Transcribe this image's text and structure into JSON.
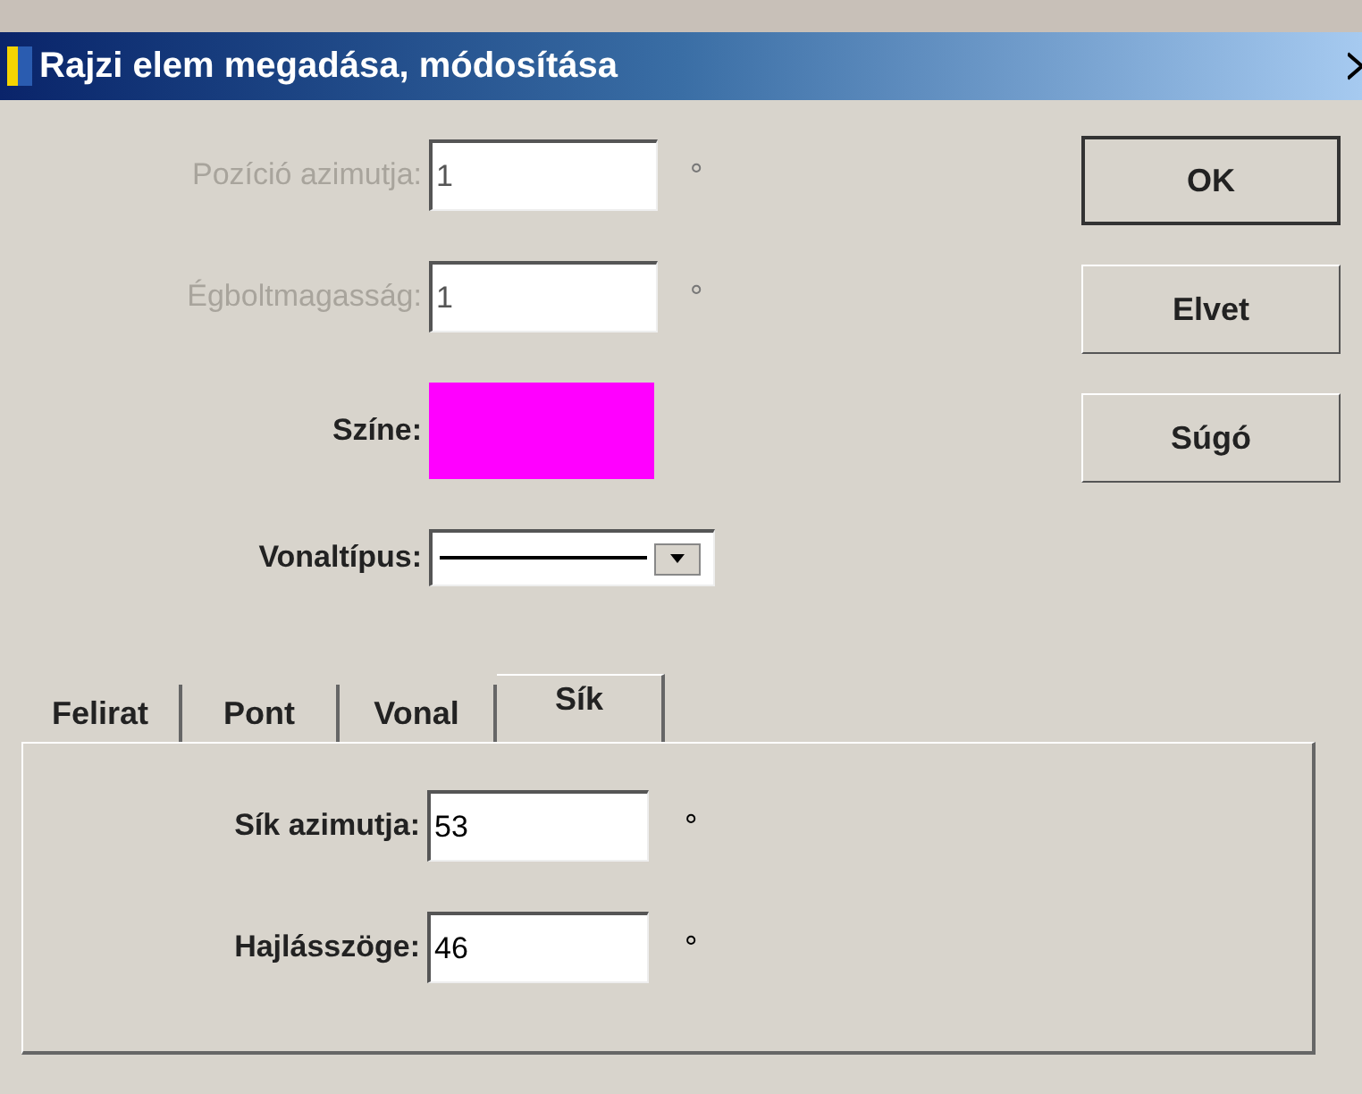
{
  "window": {
    "title": "Rajzi elem megadása, módosítása"
  },
  "fields": [
    {
      "kind": "text",
      "label": "Pozíció azimutja:",
      "value": "1",
      "unit": "°",
      "disabled": true
    },
    {
      "kind": "text",
      "label": "Égboltmagasság:",
      "value": "1",
      "unit": "°",
      "disabled": true
    },
    {
      "kind": "color",
      "label": "Színe:",
      "color": "#ff00ff"
    },
    {
      "kind": "linetype",
      "label": "Vonaltípus:"
    }
  ],
  "buttons": [
    {
      "label": "OK",
      "default": true
    },
    {
      "label": "Elvet",
      "default": false
    },
    {
      "label": "Súgó",
      "default": false
    }
  ],
  "tabs": [
    {
      "label": "Felirat",
      "selected": false
    },
    {
      "label": "Pont",
      "selected": false
    },
    {
      "label": "Vonal",
      "selected": false
    },
    {
      "label": "Sík",
      "selected": true
    }
  ],
  "tab_fields": [
    {
      "label": "Sík azimutja:",
      "value": "53",
      "unit": "°"
    },
    {
      "label": "Hajlásszöge:",
      "value": "46",
      "unit": "°"
    }
  ]
}
